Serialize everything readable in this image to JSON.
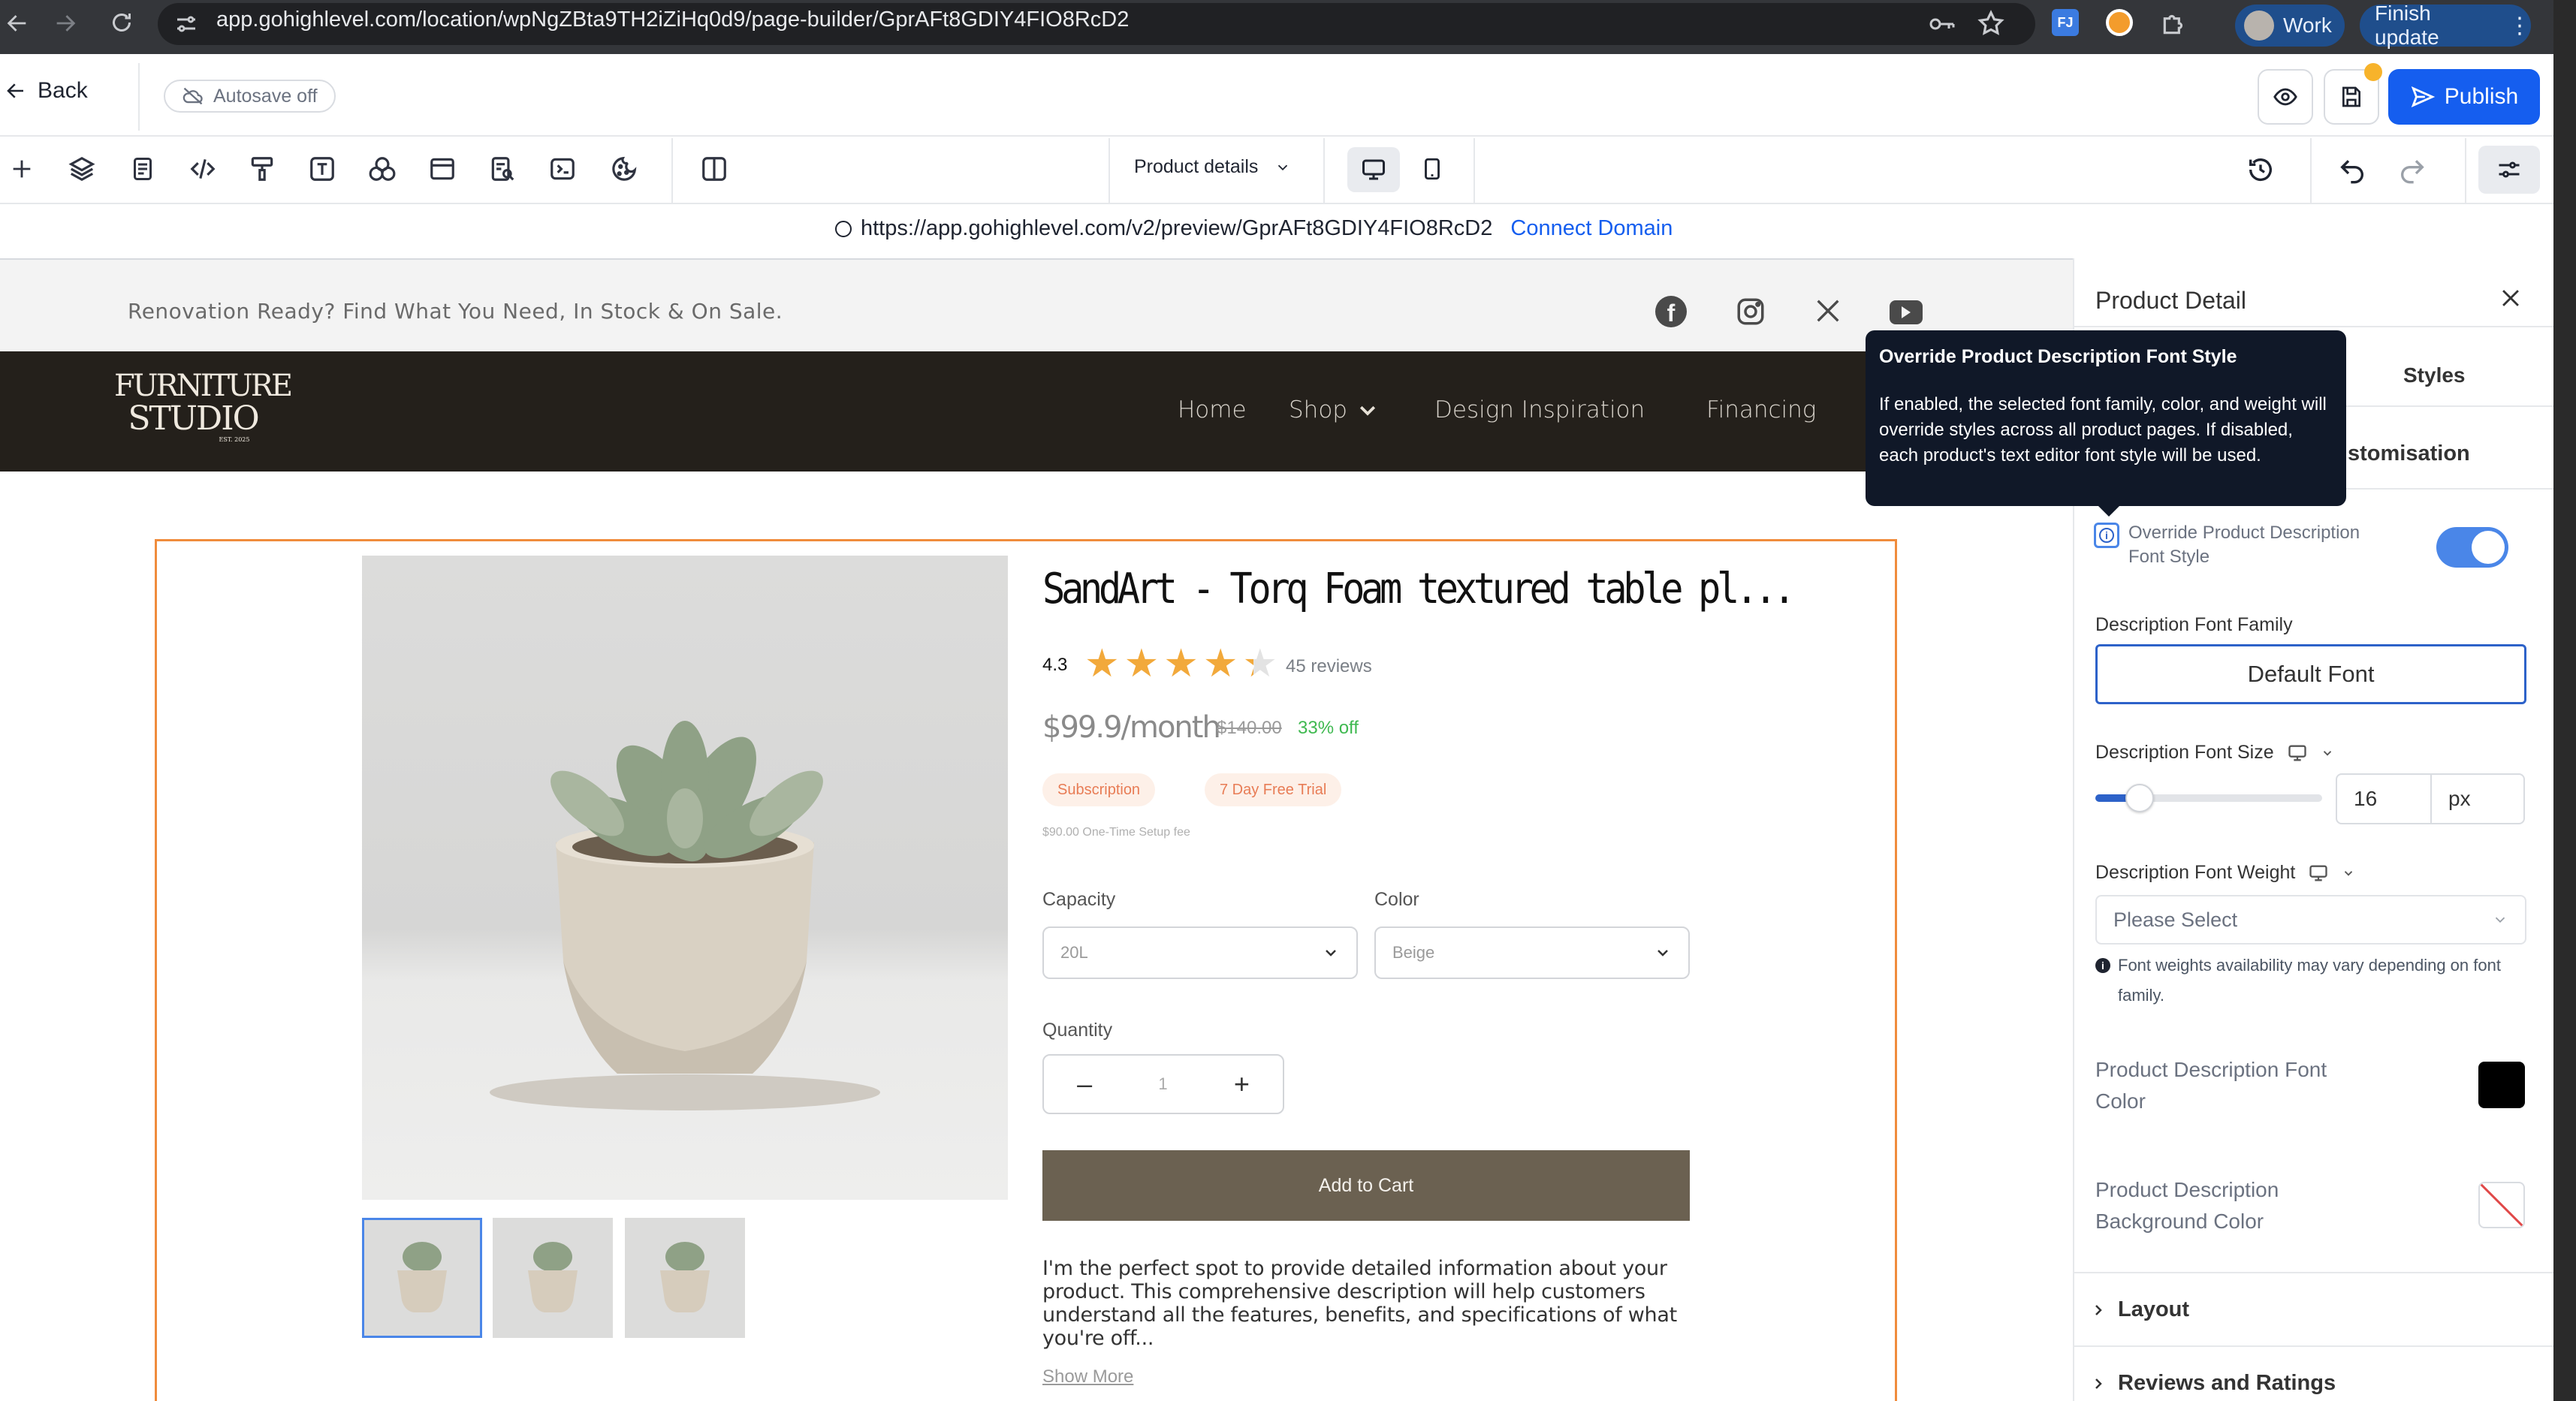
{
  "browser": {
    "url": "app.gohighlevel.com/location/wpNgZBta9TH2iZiHq0d9/page-builder/GprAFt8GDIY4FIO8RcD2",
    "profile_label": "Work",
    "update_label": "Finish update",
    "extension_badge": "FJ"
  },
  "builder": {
    "back_label": "Back",
    "autosave_label": "Autosave off",
    "publish_label": "Publish",
    "page_select_value": "Product details",
    "preview_url": "https://app.gohighlevel.com/v2/preview/GprAFt8GDIY4FIO8RcD2",
    "connect_domain_label": "Connect Domain"
  },
  "site": {
    "announcement": "Renovation Ready? Find What You Need, In Stock & On Sale.",
    "logo_line1": "FURNITURE",
    "logo_line2": "STUDIO",
    "logo_small": "EST. 2025",
    "nav": [
      "Home",
      "Shop",
      "Design Inspiration",
      "Financing"
    ]
  },
  "product": {
    "title": "SandArt - Torq Foam textured table pl...",
    "rating": "4.3",
    "rating_value": 4.3,
    "rating_max": 5,
    "reviews": "45 reviews",
    "price": "$99.9/month",
    "old_price": "$140.00",
    "discount": "33% off",
    "badge1": "Subscription",
    "badge2": "7 Day Free Trial",
    "setup_fee": "$90.00 One-Time Setup fee",
    "capacity_label": "Capacity",
    "capacity_value": "20L",
    "color_label": "Color",
    "color_value": "Beige",
    "quantity_label": "Quantity",
    "quantity_value": "1",
    "add_to_cart": "Add to Cart",
    "description": "I'm the perfect spot to provide detailed information about your product. This comprehensive description will help customers understand all the features, benefits, and specifications of what you're off...",
    "show_more": "Show More"
  },
  "panel": {
    "title": "Product Detail",
    "tab_styles": "Styles",
    "section_partial": "stomisation",
    "override_label": "Override Product Description Font Style",
    "override_on": true,
    "font_family_label": "Description Font Family",
    "font_family_value": "Default Font",
    "font_size_label": "Description Font Size",
    "font_size_value": "16",
    "font_size_unit": "px",
    "font_weight_label": "Description Font Weight",
    "font_weight_placeholder": "Please Select",
    "font_weight_note": "Font weights availability may vary depending on font family.",
    "font_color_label": "Product Description Font Color",
    "font_color": "#000000",
    "bg_color_label": "Product Description Background Color",
    "layout_label": "Layout",
    "reviews_label": "Reviews and Ratings"
  },
  "tooltip": {
    "title": "Override Product Description Font Style",
    "body": "If enabled, the selected font family, color, and weight will override styles across all product pages. If disabled, each product's text editor font style will be used."
  },
  "colors": {
    "accent": "#155eef",
    "cart_button": "#6b6151",
    "site_nav_bg": "#24201b",
    "selection_outline": "#f08c3c"
  }
}
